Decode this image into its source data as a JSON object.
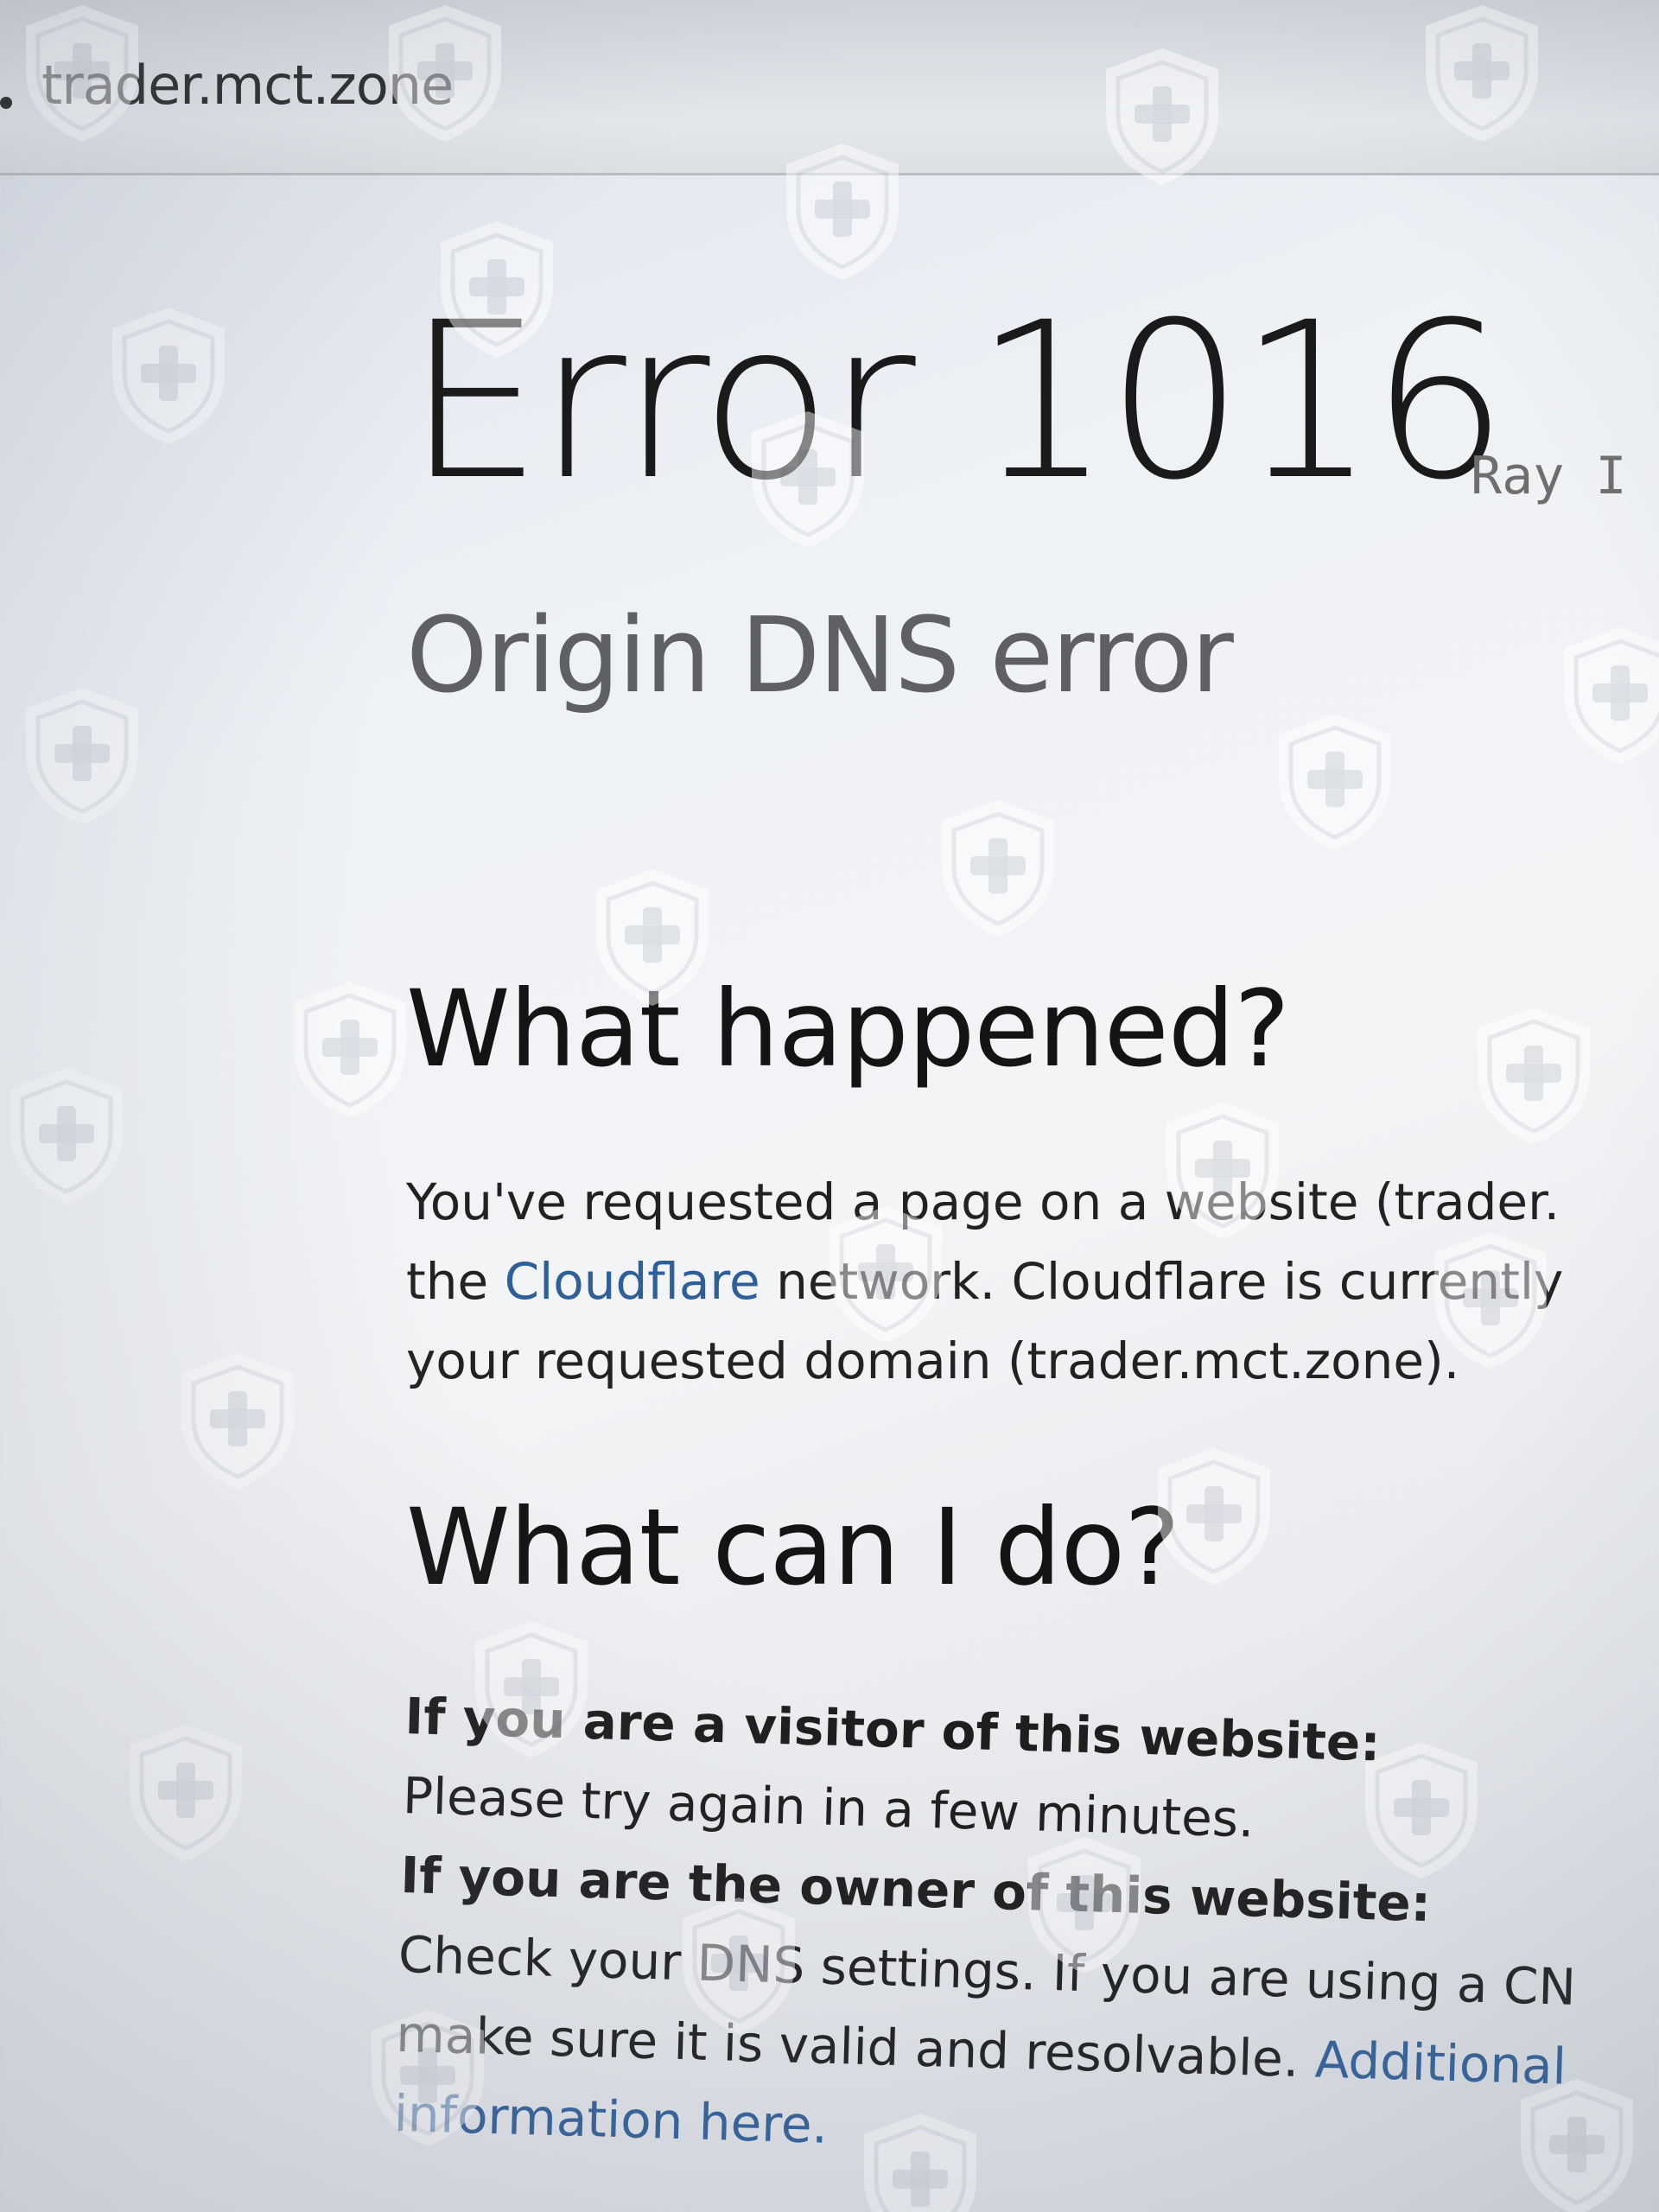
{
  "browser": {
    "url": "trader.mct.zone"
  },
  "error": {
    "title": "Error 1016",
    "ray_id_label": "Ray I",
    "subtitle": "Origin DNS error"
  },
  "what_happened": {
    "heading": "What happened?",
    "line1": "You've requested a page on a website (trader.",
    "line2_pre": "the ",
    "line2_link": "Cloudflare",
    "line2_post": " network. Cloudflare is currently",
    "line3": "your requested domain (trader.mct.zone)."
  },
  "what_can_i_do": {
    "heading": "What can I do?",
    "visitor_heading": "If you are a visitor of this website:",
    "visitor_text": "Please try again in a few minutes.",
    "owner_heading": "If you are the owner of this website:",
    "owner_line1": "Check your DNS settings. If you are using a CN",
    "owner_line2_pre": "make sure it is valid and resolvable. ",
    "owner_line2_link": "Additional",
    "owner_line3_link": "information here."
  },
  "watermark": {
    "icon": "shield-plus-icon",
    "color": "#ffffff"
  },
  "colors": {
    "link": "#2f5f99",
    "subtitle": "#5e6066",
    "ray_id": "#6e6e6e"
  }
}
